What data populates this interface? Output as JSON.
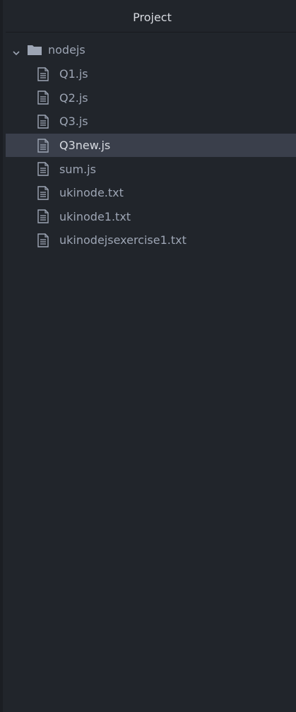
{
  "panel": {
    "title": "Project"
  },
  "tree": {
    "folder": {
      "name": "nodejs",
      "expanded": true,
      "icon": "folder-icon"
    },
    "files": [
      {
        "name": "Q1.js",
        "selected": false,
        "icon": "file-text-icon"
      },
      {
        "name": "Q2.js",
        "selected": false,
        "icon": "file-text-icon"
      },
      {
        "name": "Q3.js",
        "selected": false,
        "icon": "file-text-icon"
      },
      {
        "name": "Q3new.js",
        "selected": true,
        "icon": "file-text-icon"
      },
      {
        "name": "sum.js",
        "selected": false,
        "icon": "file-text-icon"
      },
      {
        "name": "ukinode.txt",
        "selected": false,
        "icon": "file-text-icon"
      },
      {
        "name": "ukinode1.txt",
        "selected": false,
        "icon": "file-text-icon"
      },
      {
        "name": "ukinodejsexercise1.txt",
        "selected": false,
        "icon": "file-text-icon"
      }
    ]
  },
  "colors": {
    "background": "#21252b",
    "selected_row": "#3a3f4b",
    "text": "#9da5b4",
    "text_selected": "#d7dae0"
  }
}
